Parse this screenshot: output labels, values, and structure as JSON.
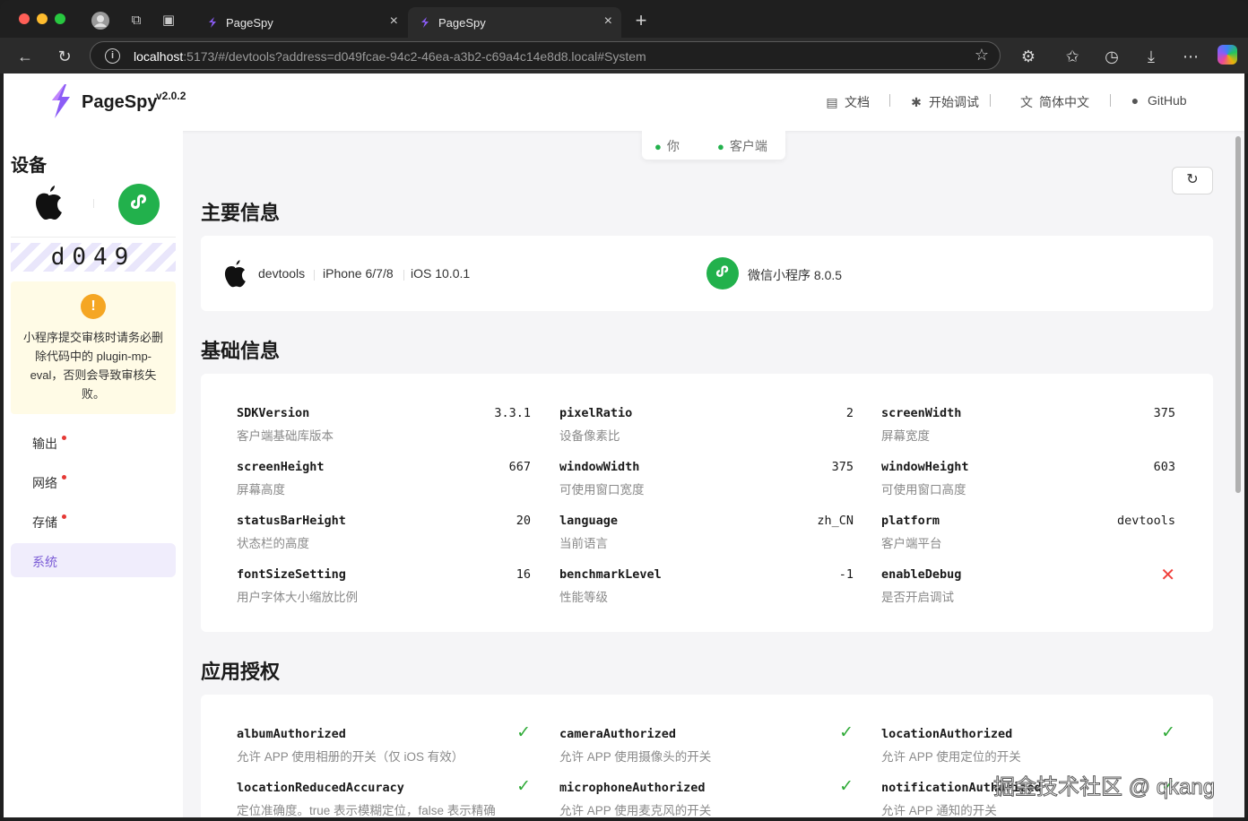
{
  "browser": {
    "tabs": [
      {
        "label": "PageSpy",
        "close": "×"
      },
      {
        "label": "PageSpy",
        "close": "×"
      }
    ],
    "new_tab": "+",
    "url_host": "localhost",
    "url_rest": ":5173/#/devtools?address=d049fcae-94c2-46ea-a3b2-c69a4c14e8d8.local#System"
  },
  "header": {
    "brand": "PageSpy",
    "version": "v2.0.2",
    "nav": [
      {
        "label": "文档",
        "icon": "document-icon"
      },
      {
        "label": "开始调试",
        "icon": "bug-icon"
      },
      {
        "label": "简体中文",
        "icon": "translate-icon"
      },
      {
        "label": "GitHub",
        "icon": "github-icon"
      }
    ]
  },
  "sidebar": {
    "title": "设备",
    "device_id": "d049",
    "warning": "小程序提交审核时请务必删除代码中的 plugin-mp-eval，否则会导致审核失败。",
    "items": [
      {
        "label": "输出",
        "dot": true
      },
      {
        "label": "网络",
        "dot": true
      },
      {
        "label": "存储",
        "dot": true
      },
      {
        "label": "系统",
        "dot": false,
        "active": true
      }
    ]
  },
  "roles": {
    "you": "你",
    "client": "客户端"
  },
  "sections": {
    "main": "主要信息",
    "basic": "基础信息",
    "auth": "应用授权"
  },
  "main_info": {
    "sdk": "devtools",
    "device": "iPhone 6/7/8",
    "os": "iOS 10.0.1",
    "platform": "微信小程序 8.0.5"
  },
  "basic_info": [
    {
      "key": "SDKVersion",
      "desc": "客户端基础库版本",
      "value": "3.3.1"
    },
    {
      "key": "pixelRatio",
      "desc": "设备像素比",
      "value": "2"
    },
    {
      "key": "screenWidth",
      "desc": "屏幕宽度",
      "value": "375"
    },
    {
      "key": "screenHeight",
      "desc": "屏幕高度",
      "value": "667"
    },
    {
      "key": "windowWidth",
      "desc": "可使用窗口宽度",
      "value": "375"
    },
    {
      "key": "windowHeight",
      "desc": "可使用窗口高度",
      "value": "603"
    },
    {
      "key": "statusBarHeight",
      "desc": "状态栏的高度",
      "value": "20"
    },
    {
      "key": "language",
      "desc": "当前语言",
      "value": "zh_CN"
    },
    {
      "key": "platform",
      "desc": "客户端平台",
      "value": "devtools"
    },
    {
      "key": "fontSizeSetting",
      "desc": "用户字体大小缩放比例",
      "value": "16"
    },
    {
      "key": "benchmarkLevel",
      "desc": "性能等级",
      "value": "-1"
    },
    {
      "key": "enableDebug",
      "desc": "是否开启调试",
      "value": false
    }
  ],
  "auth_info": [
    {
      "key": "albumAuthorized",
      "desc": "允许 APP 使用相册的开关（仅 iOS 有效）",
      "value": true
    },
    {
      "key": "cameraAuthorized",
      "desc": "允许 APP 使用摄像头的开关",
      "value": true
    },
    {
      "key": "locationAuthorized",
      "desc": "允许 APP 使用定位的开关",
      "value": true
    },
    {
      "key": "locationReducedAccuracy",
      "desc": "定位准确度。true 表示模糊定位，false 表示精确",
      "value": true
    },
    {
      "key": "microphoneAuthorized",
      "desc": "允许 APP 使用麦克风的开关",
      "value": true
    },
    {
      "key": "notificationAuthorized",
      "desc": "允许 APP 通知的开关",
      "value": true
    }
  ],
  "watermark": "掘金技术社区 @ qkang",
  "colors": {
    "accent": "#7b5cd6",
    "success": "#2eaa36",
    "danger": "#f0403c",
    "warning": "#f5a623",
    "miniprogram": "#22b14c"
  }
}
